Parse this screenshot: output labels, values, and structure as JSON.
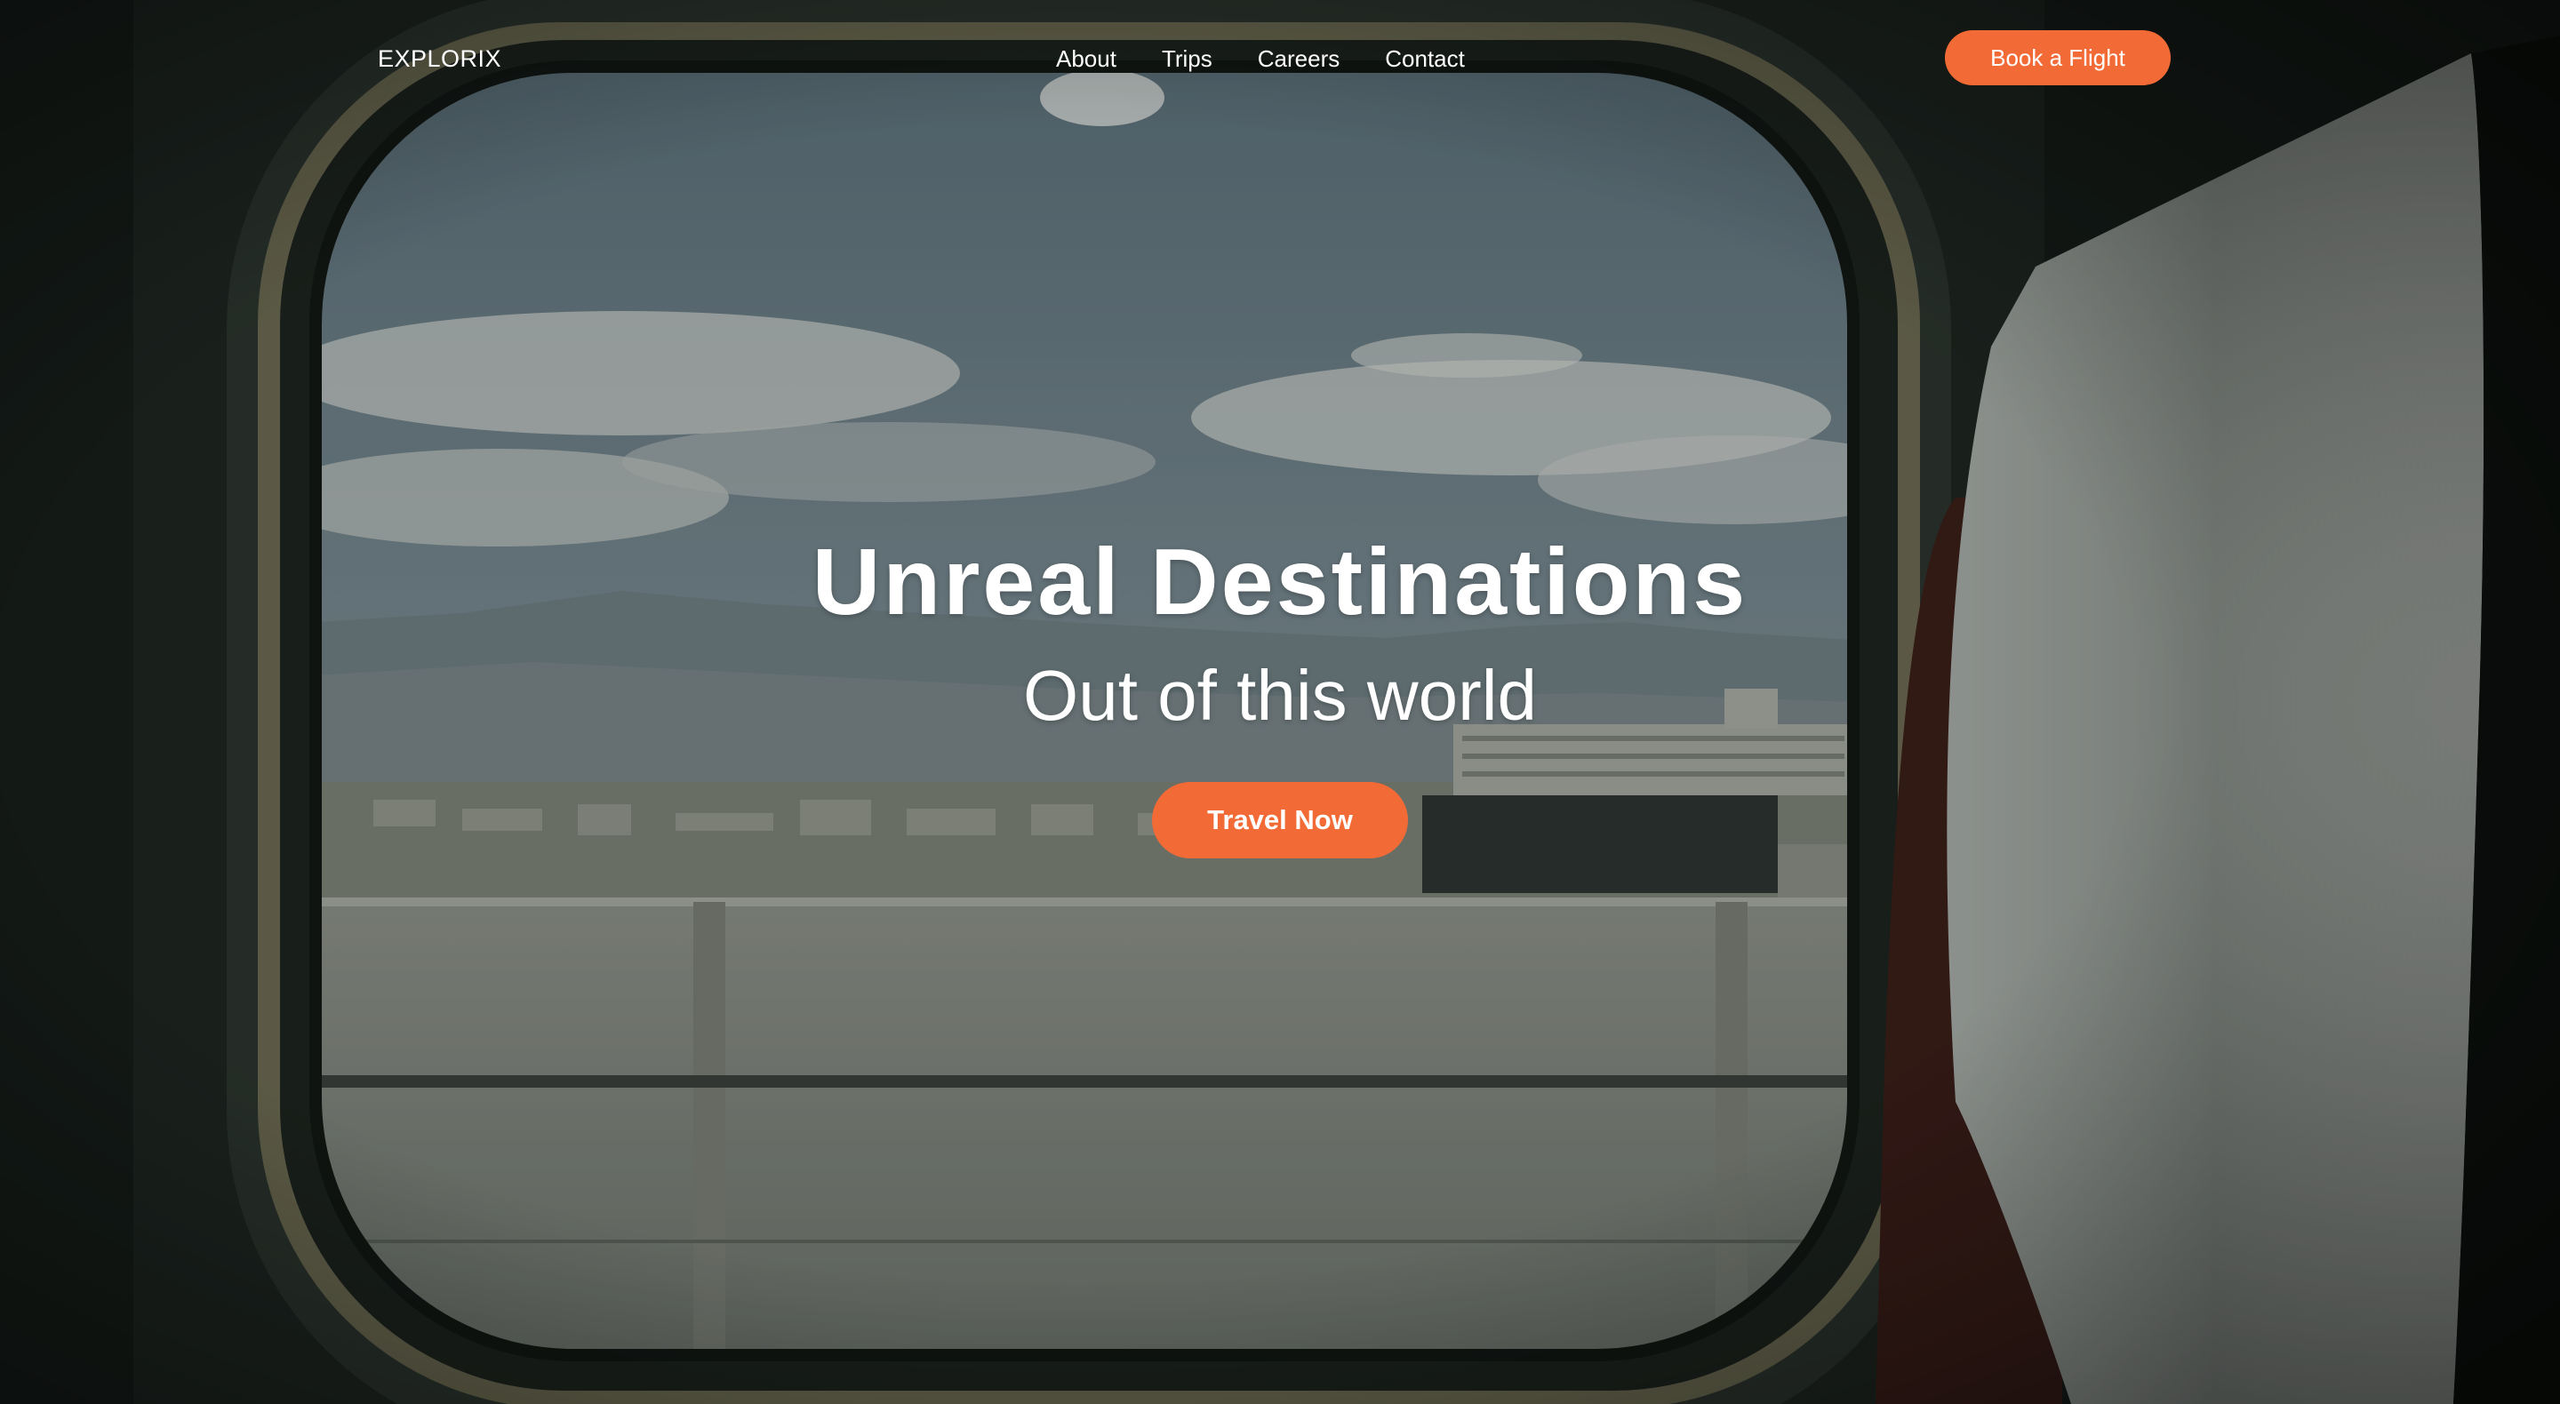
{
  "brand": {
    "logo_text": "EXPLORIX"
  },
  "nav": {
    "links": [
      {
        "label": "About"
      },
      {
        "label": "Trips"
      },
      {
        "label": "Careers"
      },
      {
        "label": "Contact"
      }
    ],
    "cta_label": "Book a Flight"
  },
  "hero": {
    "title": "Unreal Destinations",
    "subtitle": "Out of this world",
    "cta_label": "Travel Now",
    "background": "train-window-view"
  },
  "colors": {
    "accent": "#f26b36",
    "text": "#ffffff"
  }
}
